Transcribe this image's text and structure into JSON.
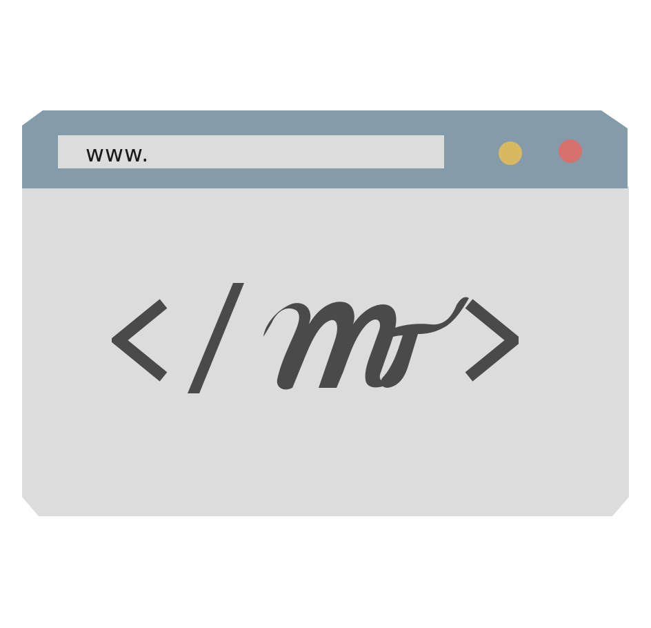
{
  "address_bar": {
    "text": "www."
  },
  "window_controls": [
    {
      "name": "minimize",
      "color": "#d8b961"
    },
    {
      "name": "close",
      "color": "#d6716e"
    }
  ],
  "logo": {
    "description_icon": "code-tag-logo-icon",
    "lettering": "</ MT >"
  },
  "colors": {
    "title_bar": "#849ca9",
    "window_body": "#dcdcdc",
    "address_bar": "#dcdcdc",
    "glyph": "#4a4a4a",
    "background": "#ffffff"
  }
}
